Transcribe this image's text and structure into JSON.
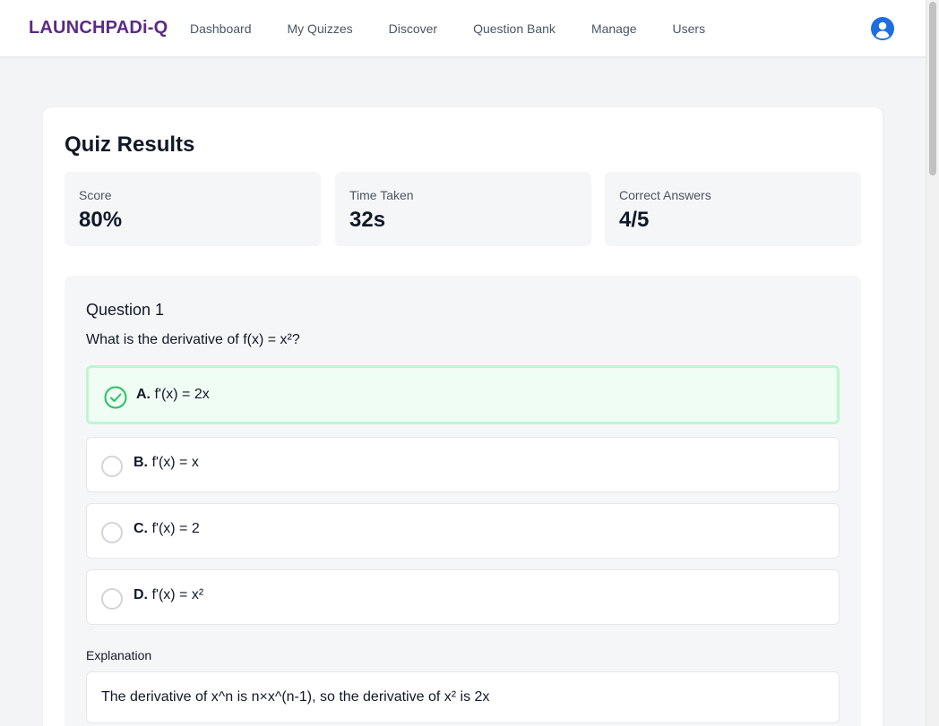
{
  "navbar": {
    "brand": "LAUNCHPADi-Q",
    "links": [
      "Dashboard",
      "My Quizzes",
      "Discover",
      "Question Bank",
      "Manage",
      "Users"
    ],
    "user_icon": "user-circle-icon",
    "accent_color": "#5b2a86",
    "user_icon_color": "#1d6fe0"
  },
  "results": {
    "title": "Quiz Results",
    "stats": [
      {
        "label": "Score",
        "value": "80%"
      },
      {
        "label": "Time Taken",
        "value": "32s"
      },
      {
        "label": "Correct Answers",
        "value": "4/5"
      }
    ]
  },
  "question": {
    "title": "Question 1",
    "text": "What is the derivative of f(x) = x²?",
    "options": [
      {
        "letter": "A.",
        "text": "f'(x) = 2x",
        "correct": true
      },
      {
        "letter": "B.",
        "text": "f'(x) = x",
        "correct": false
      },
      {
        "letter": "C.",
        "text": "f'(x) = 2",
        "correct": false
      },
      {
        "letter": "D.",
        "text": "f'(x) = x²",
        "correct": false
      }
    ],
    "explanation_label": "Explanation",
    "explanation": "The derivative of x^n is n×x^(n-1), so the derivative of x² is 2x",
    "correct_color": "#22c55e"
  }
}
